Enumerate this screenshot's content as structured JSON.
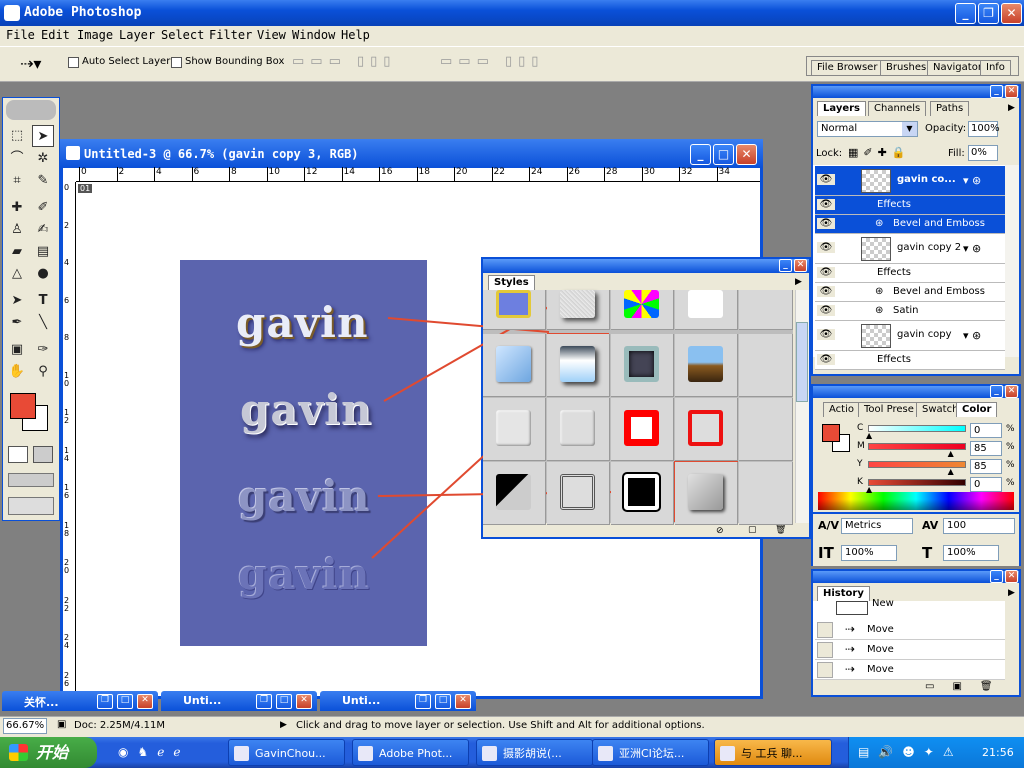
{
  "app": {
    "title": "Adobe Photoshop"
  },
  "menu": [
    "File",
    "Edit",
    "Image",
    "Layer",
    "Select",
    "Filter",
    "View",
    "Window",
    "Help"
  ],
  "options": {
    "auto_select": "Auto Select Layer",
    "show_bbox": "Show Bounding Box"
  },
  "palette_well": [
    "File Browser",
    "Brushes",
    "Navigator",
    "Info"
  ],
  "document": {
    "title": "Untitled-3 @ 66.7% (gavin copy 3, RGB)",
    "ruler_marks": [
      "0",
      "2",
      "4",
      "6",
      "8",
      "10",
      "12",
      "14",
      "16",
      "18",
      "20",
      "22",
      "24",
      "26",
      "28",
      "30",
      "32",
      "34"
    ],
    "vruler_marks": [
      "0",
      "2",
      "4",
      "6",
      "8",
      "10",
      "12",
      "14",
      "16",
      "18",
      "20",
      "22",
      "24",
      "26"
    ],
    "texts": [
      "gavin",
      "gavin",
      "gavin",
      "gavin"
    ],
    "tag": "01"
  },
  "styles": {
    "tab": "Styles"
  },
  "layers": {
    "tabs": [
      "Layers",
      "Channels",
      "Paths"
    ],
    "blend": "Normal",
    "opacity_label": "Opacity:",
    "opacity": "100%",
    "lock_label": "Lock:",
    "fill_label": "Fill:",
    "fill": "0%",
    "rows": [
      {
        "name": "gavin co...",
        "type": "layer"
      },
      {
        "name": "Effects",
        "type": "effects"
      },
      {
        "name": "Bevel and Emboss",
        "type": "effect"
      },
      {
        "name": "gavin copy 2",
        "type": "layer"
      },
      {
        "name": "Effects",
        "type": "effects"
      },
      {
        "name": "Bevel and Emboss",
        "type": "effect"
      },
      {
        "name": "Satin",
        "type": "effect"
      },
      {
        "name": "gavin copy",
        "type": "layer"
      },
      {
        "name": "Effects",
        "type": "effects"
      }
    ]
  },
  "color": {
    "tabs": [
      "Actio",
      "Tool Prese",
      "Swatch",
      "Color"
    ],
    "channels": [
      {
        "label": "C",
        "value": "0",
        "pct": "%"
      },
      {
        "label": "M",
        "value": "85",
        "pct": "%"
      },
      {
        "label": "Y",
        "value": "85",
        "pct": "%"
      },
      {
        "label": "K",
        "value": "0",
        "pct": "%"
      }
    ]
  },
  "character": {
    "font_metric": "Metrics",
    "tracking": "100",
    "vscale": "100%",
    "hscale": "100%"
  },
  "history": {
    "tab": "History",
    "rows": [
      "Move",
      "Move",
      "Move"
    ],
    "top_row": "New"
  },
  "minimized": [
    "关怀...",
    "Unti...",
    "Unti..."
  ],
  "status": {
    "zoom": "66.67%",
    "doc": "Doc: 2.25M/4.11M",
    "hint": "Click and drag to move layer or selection. Use Shift and Alt for additional options."
  },
  "taskbar": {
    "start": "开始",
    "items": [
      "GavinChou...",
      "Adobe Phot...",
      "摄影胡说(...",
      "亚洲CI论坛...",
      "与 工兵 聊..."
    ],
    "clock": "21:56"
  },
  "colors": {
    "titlebar": "#0a50d8",
    "canvas_art": "#5b64ae",
    "fg_swatch": "#e84a36",
    "annotation": "#e04a30"
  }
}
